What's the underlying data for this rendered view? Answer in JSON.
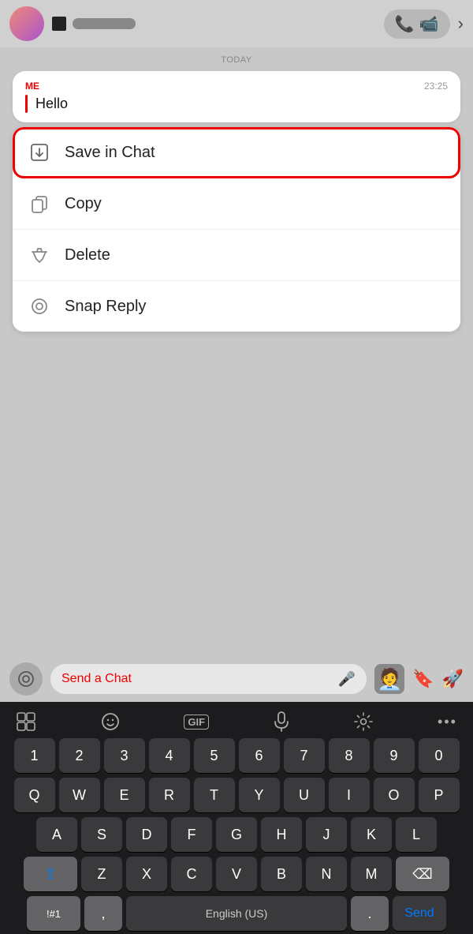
{
  "header": {
    "call_icon": "📞",
    "video_icon": "📹",
    "chevron_icon": "›"
  },
  "chat": {
    "today_label": "TODAY",
    "message": {
      "sender": "ME",
      "time": "23:25",
      "text": "Hello"
    }
  },
  "context_menu": {
    "items": [
      {
        "id": "save-in-chat",
        "label": "Save in Chat",
        "highlighted": true
      },
      {
        "id": "copy",
        "label": "Copy",
        "highlighted": false
      },
      {
        "id": "delete",
        "label": "Delete",
        "highlighted": false
      },
      {
        "id": "snap-reply",
        "label": "Snap Reply",
        "highlighted": false
      }
    ]
  },
  "input_bar": {
    "placeholder": "Send a Chat",
    "camera_icon": "⊙",
    "mic_icon": "🎤"
  },
  "keyboard": {
    "toolbar": [
      "😀",
      "☺",
      "GIF",
      "🎤",
      "⚙",
      "•••"
    ],
    "rows": [
      [
        "1",
        "2",
        "3",
        "4",
        "5",
        "6",
        "7",
        "8",
        "9",
        "0"
      ],
      [
        "Q",
        "W",
        "E",
        "R",
        "T",
        "Y",
        "U",
        "I",
        "O",
        "P"
      ],
      [
        "A",
        "S",
        "D",
        "F",
        "G",
        "H",
        "J",
        "K",
        "L"
      ],
      [
        "Z",
        "X",
        "C",
        "V",
        "B",
        "N",
        "M"
      ],
      [
        "!#1",
        ",",
        "English (US)",
        ".",
        "Send"
      ]
    ]
  }
}
